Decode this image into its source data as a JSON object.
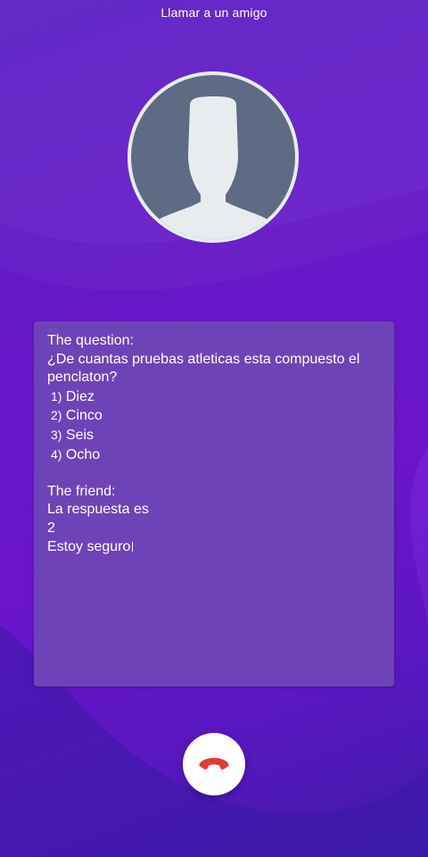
{
  "header": {
    "title": "Llamar a un amigo"
  },
  "avatar": {
    "icon": "person-silhouette-icon"
  },
  "panel": {
    "question_label": "The question:",
    "question_line1": "¿De cuantas pruebas atleticas esta compuesto el",
    "question_line2": "penclaton?",
    "options": [
      {
        "num": "1)",
        "text": "Diez"
      },
      {
        "num": "2)",
        "text": "Cinco"
      },
      {
        "num": "3)",
        "text": "Seis"
      },
      {
        "num": "4)",
        "text": "Ocho"
      }
    ],
    "friend_label": "The friend:",
    "answer_intro": "La respuesta es",
    "answer_value": "2",
    "confidence": "Estoy seguro"
  },
  "controls": {
    "hangup_icon": "phone-hangup-icon",
    "hangup_color": "#e53935"
  },
  "colors": {
    "background": "#6818c8",
    "panel": "#6f43b8",
    "avatar_bg": "#5f6b84"
  }
}
